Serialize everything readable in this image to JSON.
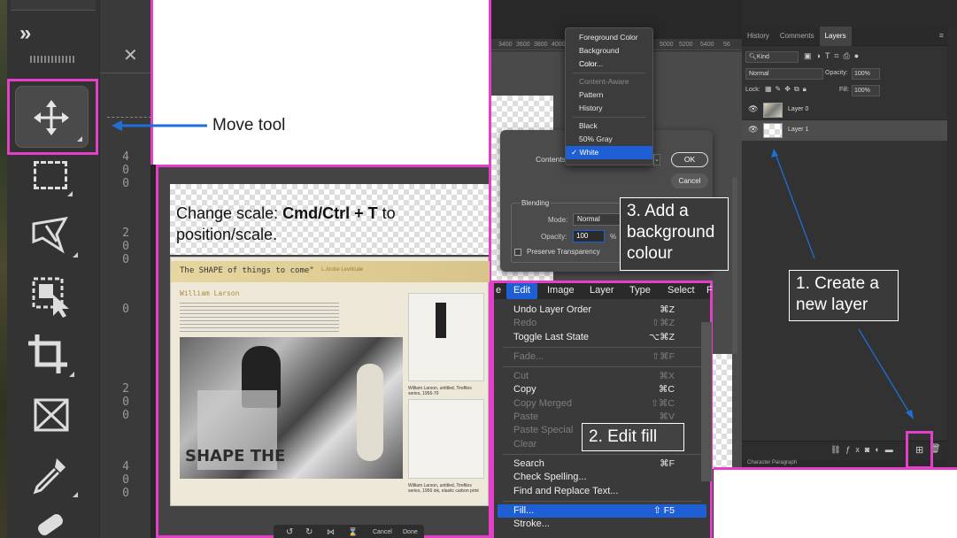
{
  "toolbar": {
    "collapse_glyph": "»",
    "tools": [
      {
        "name": "move-tool-icon"
      },
      {
        "name": "marquee-tool-icon"
      },
      {
        "name": "lasso-tool-icon"
      },
      {
        "name": "object-selection-tool-icon"
      },
      {
        "name": "crop-tool-icon"
      },
      {
        "name": "frame-tool-icon"
      },
      {
        "name": "eyedropper-tool-icon"
      },
      {
        "name": "healing-tool-icon"
      }
    ],
    "ruler_numbers": [
      "4\n0\n0",
      "2\n0\n0",
      "0",
      "2\n0\n0",
      "4\n0\n0"
    ],
    "close_glyph": "✕"
  },
  "annotations": {
    "move_tool": "Move tool",
    "change_scale_prefix": "Change scale:  ",
    "change_scale_shortcut": "Cmd/Ctrl + T",
    "change_scale_suffix": " to",
    "change_scale_line2": "position/scale.",
    "step1": "1. Create a new layer",
    "step2": "2. Edit fill",
    "step3": "3. Add a background colour"
  },
  "canvas": {
    "doc_title": "The SHAPE of things to come\"",
    "doc_title_aside": "L.Arcbe Leviticale",
    "author_heading": "William Larson",
    "caption_right": "William Larson, untitled, Tirefiles series, 1956-70",
    "caption_bottom": "William Larson, untitled, Tirefiles series, 1956 ink, elastic carbon print",
    "transform_bar": {
      "cancel": "Cancel",
      "done": "Done"
    }
  },
  "fill_dialog": {
    "dropdown_items": [
      {
        "label": "Foreground Color",
        "state": "normal"
      },
      {
        "label": "Background Color",
        "state": "normal"
      },
      {
        "label": "Color...",
        "state": "normal"
      },
      {
        "label": "Content-Aware",
        "state": "dim"
      },
      {
        "label": "Pattern",
        "state": "normal"
      },
      {
        "label": "History",
        "state": "normal"
      },
      {
        "label": "Black",
        "state": "normal"
      },
      {
        "label": "50% Gray",
        "state": "normal"
      },
      {
        "label": "White",
        "state": "selected"
      }
    ],
    "contents_label": "Contents:",
    "ok": "OK",
    "cancel": "Cancel",
    "blending_label": "Blending",
    "mode_label": "Mode:",
    "mode_value": "Normal",
    "opacity_label": "Opacity:",
    "opacity_value": "100",
    "opacity_unit": "%",
    "preserve_label": "Preserve Transparency"
  },
  "top_ruler": [
    "3400",
    "3600",
    "3800",
    "4000",
    "5000",
    "5200",
    "5400",
    "56"
  ],
  "layers_panel": {
    "tabs": [
      "History",
      "Comments",
      "Layers"
    ],
    "active_tab": "Layers",
    "kind_label": "Kind",
    "blend_mode": "Normal",
    "opacity_label": "Opacity:",
    "opacity_value": "100%",
    "lock_label": "Lock:",
    "fill_label": "Fill:",
    "fill_value": "100%",
    "layers": [
      {
        "name": "Layer 0",
        "selected": false
      },
      {
        "name": "Layer 1",
        "selected": true
      }
    ],
    "bottom_tabs": [
      "Character",
      "Paragraph"
    ]
  },
  "edit_menu": {
    "menubar": [
      "e",
      "Edit",
      "Image",
      "Layer",
      "Type",
      "Select",
      "F"
    ],
    "active_menu": "Edit",
    "items": [
      {
        "label": "Undo Layer Order",
        "shortcut": "⌘Z",
        "dim": false
      },
      {
        "label": "Redo",
        "shortcut": "⇧⌘Z",
        "dim": true
      },
      {
        "label": "Toggle Last State",
        "shortcut": "⌥⌘Z",
        "dim": false
      },
      {
        "sep": true
      },
      {
        "label": "Fade...",
        "shortcut": "⇧⌘F",
        "dim": true
      },
      {
        "sep": true
      },
      {
        "label": "Cut",
        "shortcut": "⌘X",
        "dim": true
      },
      {
        "label": "Copy",
        "shortcut": "⌘C",
        "dim": false
      },
      {
        "label": "Copy Merged",
        "shortcut": "⇧⌘C",
        "dim": true
      },
      {
        "label": "Paste",
        "shortcut": "⌘V",
        "dim": true
      },
      {
        "label": "Paste Special",
        "shortcut": "",
        "dim": true
      },
      {
        "label": "Clear",
        "shortcut": "",
        "dim": true
      },
      {
        "sep": true
      },
      {
        "label": "Search",
        "shortcut": "⌘F",
        "dim": false
      },
      {
        "label": "Check Spelling...",
        "shortcut": "",
        "dim": false
      },
      {
        "label": "Find and Replace Text...",
        "shortcut": "",
        "dim": false
      },
      {
        "sep": true
      },
      {
        "label": "Fill...",
        "shortcut": "⇧ F5",
        "dim": false,
        "selected": true
      },
      {
        "label": "Stroke...",
        "shortcut": "",
        "dim": false
      }
    ]
  },
  "colors": {
    "highlight": "#e33fc8",
    "arrow": "#1f6fd8",
    "menu_select": "#1f5fd6"
  }
}
